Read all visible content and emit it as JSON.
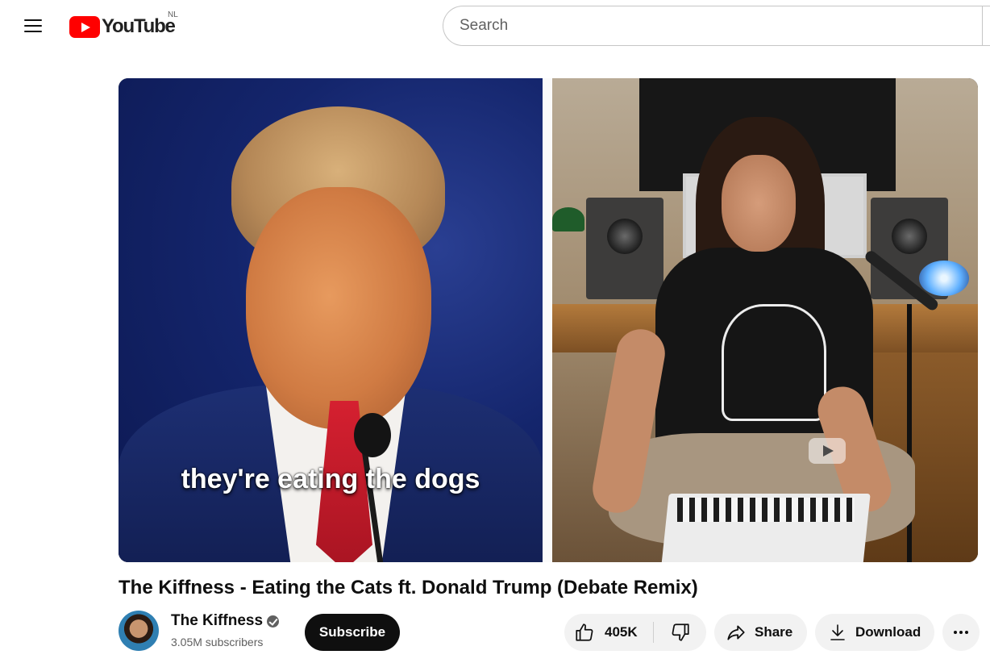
{
  "header": {
    "logo_text": "YouTube",
    "country_code": "NL",
    "search_placeholder": "Search"
  },
  "player": {
    "caption": "they're eating the dogs"
  },
  "video": {
    "title": "The Kiffness - Eating the Cats ft. Donald Trump (Debate Remix)"
  },
  "channel": {
    "name": "The Kiffness",
    "subscribers": "3.05M subscribers",
    "subscribe_label": "Subscribe",
    "verified": true
  },
  "actions": {
    "likes": "405K",
    "share_label": "Share",
    "download_label": "Download",
    "more_icon": "more-horizontal-icon"
  },
  "colors": {
    "brand_red": "#ff0000",
    "text_primary": "#0f0f0f",
    "text_secondary": "#606060",
    "pill_bg": "#f2f2f2"
  }
}
